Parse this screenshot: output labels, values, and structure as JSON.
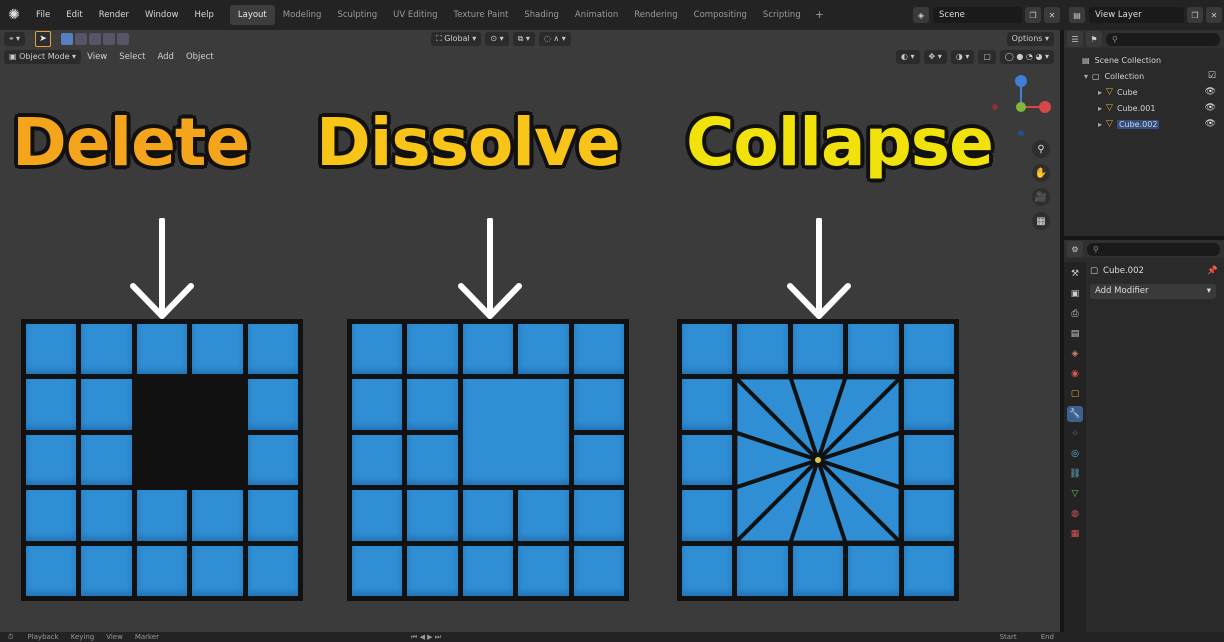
{
  "menu": {
    "items": [
      "File",
      "Edit",
      "Render",
      "Window",
      "Help"
    ]
  },
  "workspaces": {
    "tabs": [
      "Layout",
      "Modeling",
      "Sculpting",
      "UV Editing",
      "Texture Paint",
      "Shading",
      "Animation",
      "Rendering",
      "Compositing",
      "Scripting"
    ],
    "active": "Layout",
    "add": "+"
  },
  "scene": {
    "name": "Scene"
  },
  "view_layer": {
    "name": "View Layer"
  },
  "viewport": {
    "mode": "Object Mode",
    "menus": [
      "View",
      "Select",
      "Add",
      "Object"
    ],
    "transform_orientation": "Global",
    "options_label": "Options"
  },
  "overlay": {
    "titles": [
      {
        "text": "Delete",
        "color": "#f5a51c"
      },
      {
        "text": "Dissolve",
        "color": "#f7c417"
      },
      {
        "text": "Collapse",
        "color": "#f2e20c"
      }
    ]
  },
  "colors": {
    "face": "#2f8ed4",
    "edge": "#111111",
    "viewport_bg": "#3b3b3b",
    "accent": "#e8a13c"
  },
  "outliner": {
    "root": "Scene Collection",
    "collection": "Collection",
    "objects": [
      "Cube",
      "Cube.001",
      "Cube.002"
    ]
  },
  "properties": {
    "object_name": "Cube.002",
    "add_modifier": "Add Modifier"
  },
  "timeline": {
    "menus": [
      "Playback",
      "Keying",
      "View",
      "Marker"
    ],
    "start_label": "Start",
    "end_label": "End"
  }
}
